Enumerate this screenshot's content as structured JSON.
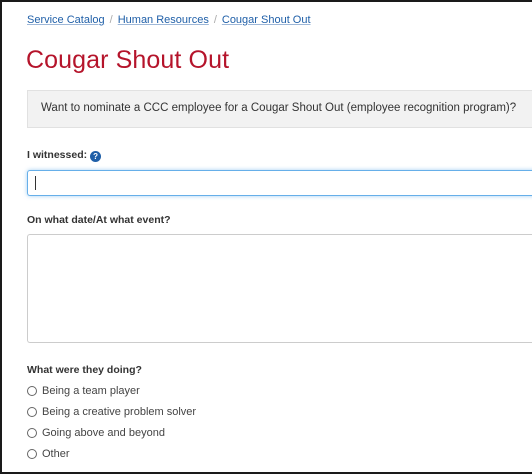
{
  "breadcrumb": {
    "items": [
      "Service Catalog",
      "Human Resources",
      "Cougar Shout Out"
    ],
    "separator": "/"
  },
  "page": {
    "title": "Cougar Shout Out",
    "intro": "Want to nominate a CCC employee for a Cougar Shout Out (employee recognition program)?"
  },
  "form": {
    "witnessed": {
      "label": "I witnessed:",
      "help_icon": "question-circle-icon",
      "value": ""
    },
    "date_event": {
      "label": "On what date/At what event?",
      "value": ""
    },
    "doing": {
      "label": "What were they doing?",
      "options": [
        "Being a team player",
        "Being a creative problem solver",
        "Going above and beyond",
        "Other"
      ]
    }
  },
  "colors": {
    "title": "#b5142b",
    "link": "#1f5fa8",
    "focus_border": "#66afe9",
    "info_bg": "#f2f2f2"
  }
}
